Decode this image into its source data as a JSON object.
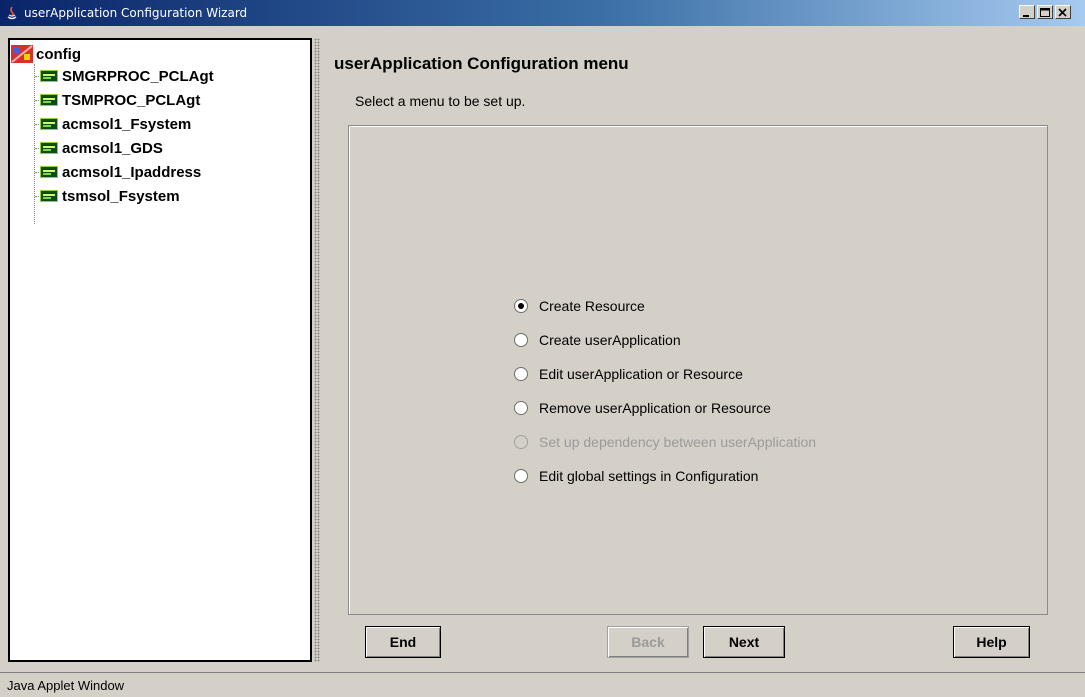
{
  "window": {
    "title": "userApplication Configuration Wizard",
    "controls": {
      "minimize": "minimize-icon",
      "maximize": "maximize-icon",
      "close": "close-icon"
    }
  },
  "tree": {
    "root": {
      "label": "config",
      "icon": "config-icon"
    },
    "items": [
      {
        "label": "SMGRPROC_PCLAgt",
        "icon": "resource-icon"
      },
      {
        "label": "TSMPROC_PCLAgt",
        "icon": "resource-icon"
      },
      {
        "label": "acmsol1_Fsystem",
        "icon": "resource-icon"
      },
      {
        "label": "acmsol1_GDS",
        "icon": "resource-icon"
      },
      {
        "label": "acmsol1_Ipaddress",
        "icon": "resource-icon"
      },
      {
        "label": "tsmsol_Fsystem",
        "icon": "resource-icon"
      }
    ]
  },
  "main": {
    "title": "userApplication Configuration menu",
    "subtitle": "Select a menu to be set up.",
    "options": [
      {
        "label": "Create Resource",
        "selected": true,
        "enabled": true
      },
      {
        "label": "Create userApplication",
        "selected": false,
        "enabled": true
      },
      {
        "label": "Edit userApplication or Resource",
        "selected": false,
        "enabled": true
      },
      {
        "label": "Remove userApplication or Resource",
        "selected": false,
        "enabled": true
      },
      {
        "label": "Set up dependency between userApplication",
        "selected": false,
        "enabled": false
      },
      {
        "label": "Edit global settings in Configuration",
        "selected": false,
        "enabled": true
      }
    ]
  },
  "buttons": {
    "end": "End",
    "back": "Back",
    "next": "Next",
    "help": "Help"
  },
  "status": {
    "text": "Java Applet Window"
  }
}
